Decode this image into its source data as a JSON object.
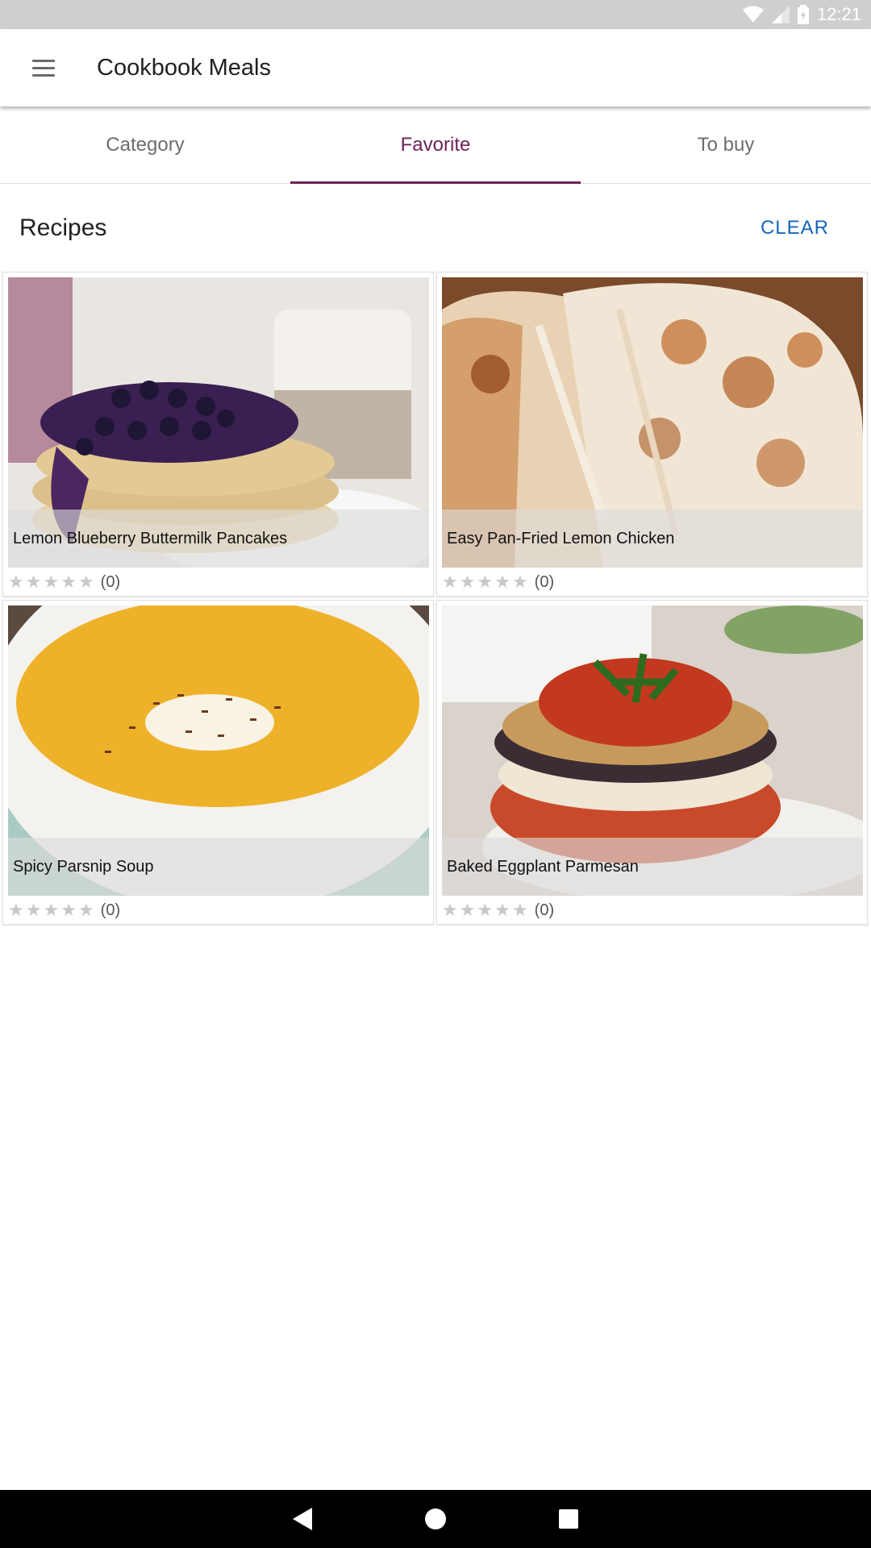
{
  "status_bar": {
    "time": "12:21"
  },
  "app_bar": {
    "title": "Cookbook Meals",
    "menu_icon": "hamburger-menu-icon"
  },
  "tabs": [
    {
      "label": "Category",
      "active": false
    },
    {
      "label": "Favorite",
      "active": true
    },
    {
      "label": "To buy",
      "active": false
    }
  ],
  "section": {
    "title": "Recipes",
    "clear_label": "CLEAR"
  },
  "colors": {
    "accent": "#6b2358",
    "link": "#1565c0",
    "status_bar": "#cfcfcf"
  },
  "recipes": [
    {
      "name": "Lemon Blueberry Buttermilk Pancakes",
      "rating": 0,
      "rating_count": "(0)"
    },
    {
      "name": "Easy Pan-Fried Lemon Chicken",
      "rating": 0,
      "rating_count": "(0)"
    },
    {
      "name": "Spicy Parsnip Soup",
      "rating": 0,
      "rating_count": "(0)"
    },
    {
      "name": "Baked Eggplant Parmesan",
      "rating": 0,
      "rating_count": "(0)"
    }
  ],
  "nav_bar": {
    "back_icon": "back-triangle-icon",
    "home_icon": "home-circle-icon",
    "recents_icon": "recents-square-icon"
  }
}
